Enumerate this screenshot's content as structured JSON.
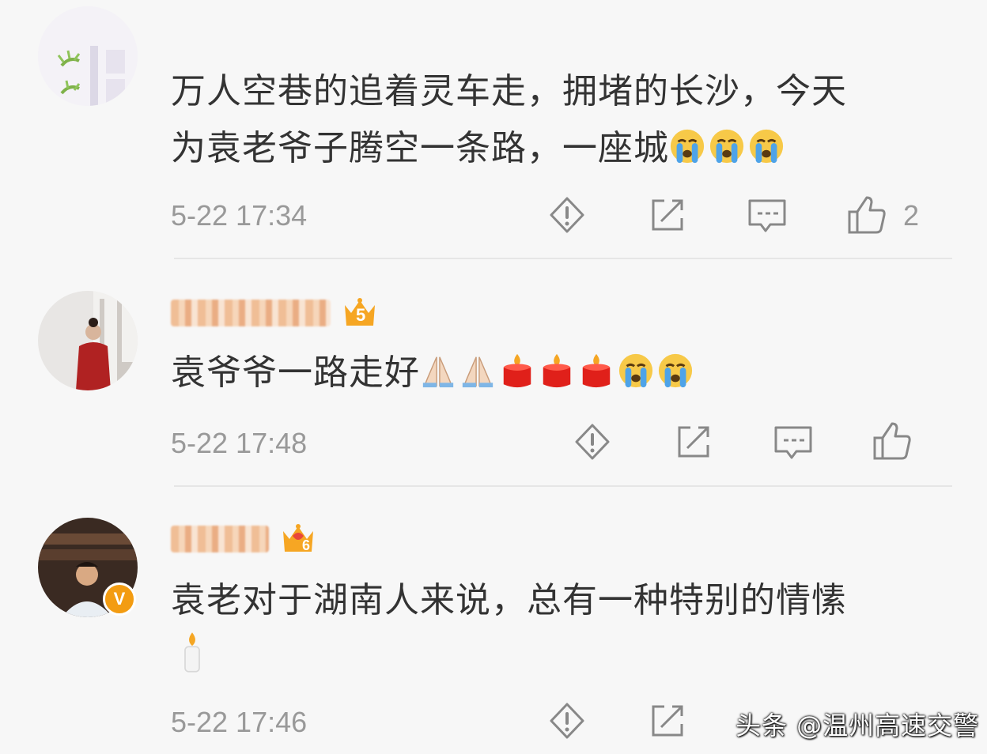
{
  "comments": [
    {
      "text_line1": "万人空巷的追着灵车走，拥堵的长沙，今天",
      "text_line2": "为袁老爷子腾空一条路，一座城",
      "time": "5-22 17:34",
      "like_count": "2",
      "emojis": [
        "crying-face-emoji",
        "crying-face-emoji",
        "crying-face-emoji"
      ]
    },
    {
      "badge_level": "5",
      "text": "袁爷爷一路走好",
      "time": "5-22 17:48",
      "emojis": [
        "folded-hands-emoji",
        "folded-hands-emoji",
        "candle-emoji",
        "candle-emoji",
        "candle-emoji",
        "crying-face-emoji",
        "crying-face-emoji"
      ]
    },
    {
      "badge_level": "6",
      "text_line1": "袁老对于湖南人来说，总有一种特别的情愫",
      "time": "5-22 17:46",
      "verified": "V",
      "emojis": [
        "white-candle-emoji"
      ]
    }
  ],
  "actions": [
    "report-icon",
    "share-icon",
    "comment-icon",
    "like-icon"
  ],
  "watermark": "头条 @温州高速交警",
  "colors": {
    "accent_badge": "#f39c12",
    "text": "#333333",
    "meta": "#999999",
    "background": "#f7f7f7"
  }
}
